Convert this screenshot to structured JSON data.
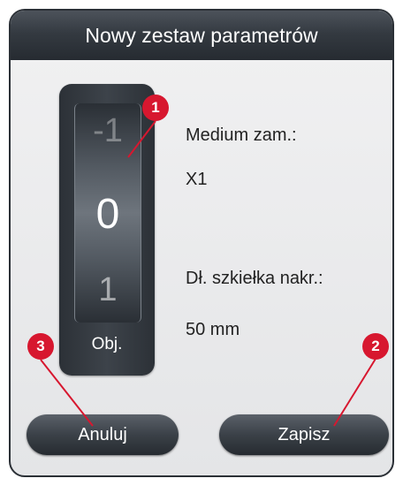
{
  "dialog": {
    "title": "Nowy zestaw parametrów"
  },
  "drum": {
    "value_above": "-1",
    "value_selected": "0",
    "value_below": "1",
    "label": "Obj."
  },
  "fields": {
    "medium_label": "Medium zam.:",
    "medium_value": "X1",
    "length_label": "Dł. szkiełka nakr.:",
    "length_value": "50 mm"
  },
  "buttons": {
    "cancel_label": "Anuluj",
    "save_label": "Zapisz"
  },
  "callouts": [
    "1",
    "2",
    "3"
  ],
  "colors": {
    "callout": "#d7172f",
    "titlebar": "#343a41",
    "dialog_bg": "#e9eaec"
  }
}
